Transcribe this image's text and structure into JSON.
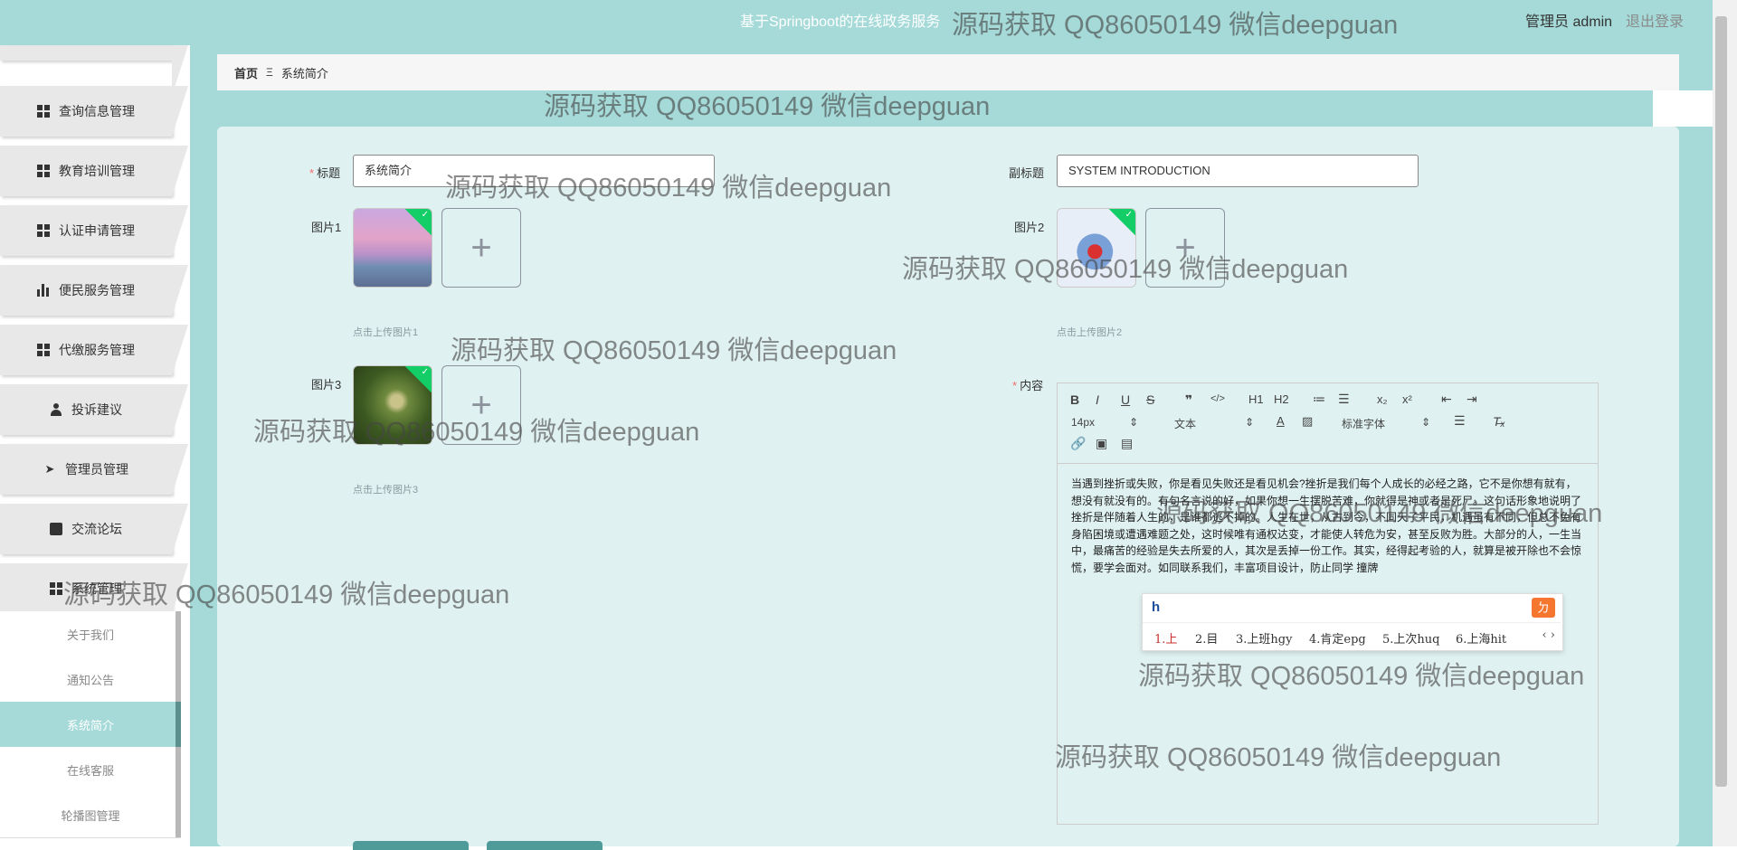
{
  "header": {
    "title": "基于Springboot的在线政务服务",
    "user": "管理员 admin",
    "logout": "退出登录"
  },
  "sidebar": {
    "items": [
      {
        "label": "查询信息管理",
        "icon": "grid-icon"
      },
      {
        "label": "教育培训管理",
        "icon": "grid-icon"
      },
      {
        "label": "认证申请管理",
        "icon": "grid-icon"
      },
      {
        "label": "便民服务管理",
        "icon": "bar-chart-icon"
      },
      {
        "label": "代缴服务管理",
        "icon": "grid-icon"
      },
      {
        "label": "投诉建议",
        "icon": "user-icon"
      },
      {
        "label": "管理员管理",
        "icon": "paper-plane-icon"
      },
      {
        "label": "交流论坛",
        "icon": "clipboard-icon"
      },
      {
        "label": "系统管理",
        "icon": "grid-icon"
      }
    ],
    "submenu": [
      {
        "label": "关于我们"
      },
      {
        "label": "通知公告"
      },
      {
        "label": "系统简介",
        "active": true
      },
      {
        "label": "在线客服"
      },
      {
        "label": "轮播图管理"
      }
    ]
  },
  "breadcrumb": {
    "home": "首页",
    "separator": "Ξ",
    "current": "系统简介"
  },
  "form": {
    "title_label": "标题",
    "title_value": "系统简介",
    "subtitle_label": "副标题",
    "subtitle_value": "SYSTEM INTRODUCTION",
    "pic1_label": "图片1",
    "pic1_tip": "点击上传图片1",
    "pic2_label": "图片2",
    "pic2_tip": "点击上传图片2",
    "pic3_label": "图片3",
    "pic3_tip": "点击上传图片3",
    "content_label": "内容",
    "required_mark": "*",
    "upload_plus": "+"
  },
  "editor": {
    "toolbar_row1": [
      "B",
      "I",
      "U",
      "S",
      "❞",
      "</>",
      "H1",
      "H2",
      "≔",
      "☰",
      "x₂",
      "x²",
      "⇤",
      "⇥"
    ],
    "font_size": "14px",
    "paragraph": "文本",
    "font_family": "标准字体",
    "content": "当遇到挫折或失败，你是看见失败还是看见机会?挫折是我们每个人成长的必经之路，它不是你想有就有，想没有就没有的。有句名言说的好，如果你想一生摆脱苦难，你就得是神或者是死尸。这句话形象地说明了挫折是伴随着人生的，是谁都逃不掉的。人生在世，从古到今，不同天子平民，机遇虽有不同，但总不免有身陷困境或遭遇难题之处，这时候唯有通权达变，才能使人转危为安，甚至反败为胜。大部分的人，一生当中，最痛苦的经验是失去所爱的人，其次是丢掉一份工作。其实，经得起考验的人，就算是被开除也不会惊慌，要学会面对。如同联系我们，丰富项目设计，防止同学 撞牌"
  },
  "ime": {
    "input": "h",
    "candidates": [
      "1.上",
      "2.目",
      "3.上班hgy",
      "4.肯定epg",
      "5.上次huq",
      "6.上海hit"
    ],
    "nav": "‹ ›"
  },
  "watermark": "源码获取 QQ86050149 微信deepguan"
}
